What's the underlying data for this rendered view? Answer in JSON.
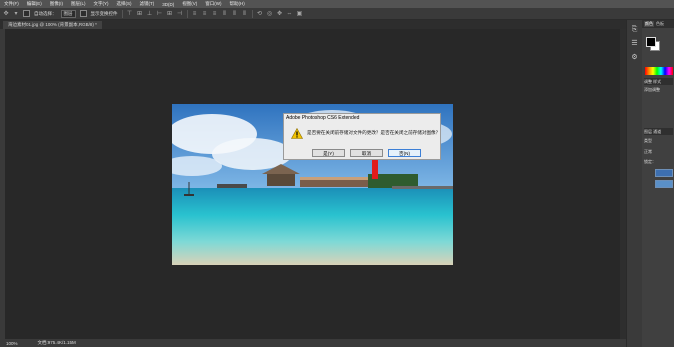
{
  "menu": [
    "文件(F)",
    "编辑(E)",
    "图像(I)",
    "图层(L)",
    "文字(Y)",
    "选择(S)",
    "滤镜(T)",
    "3D(D)",
    "视图(V)",
    "窗口(W)",
    "帮助(H)"
  ],
  "options": {
    "auto_select": "自动选择：",
    "layer_select": "图层",
    "show_transform": "显示变换控件"
  },
  "document_tab": "海边素材01.jpg @ 100% (背景副本,RGB/8) *",
  "panels": {
    "top_tabs": [
      "颜色",
      "色板"
    ],
    "adjust_tabs": [
      "调整",
      "样式"
    ],
    "adjust_title": "添加调整",
    "layer_tabs": [
      "图层",
      "通道",
      "路径"
    ],
    "kind_label": "类型",
    "normal_label": "正常",
    "lock_label": "锁定："
  },
  "dialog": {
    "title": "Adobe Photoshop CS6 Extended",
    "message": "是否要在关闭前存储对文件的更改？是否在关闭之前存储对图像？",
    "buttons": [
      "是(Y)",
      "取消",
      "否(N)"
    ],
    "focused_index": 2
  },
  "status": {
    "zoom": "100%",
    "doc_info": "文档:975.4K/1.15M"
  },
  "colors": {
    "dialog_focus": "#3c7fd6",
    "warning": "#f2c200"
  }
}
